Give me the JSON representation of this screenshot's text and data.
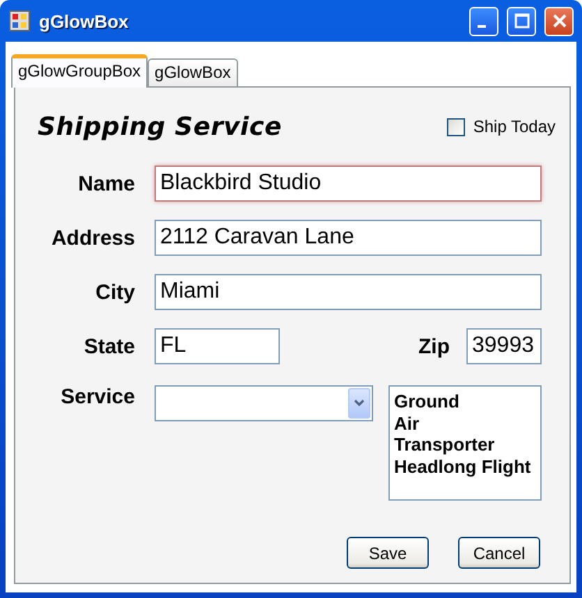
{
  "window": {
    "title": "gGlowBox"
  },
  "tabs": [
    {
      "label": "gGlowGroupBox",
      "selected": true
    },
    {
      "label": "gGlowBox",
      "selected": false
    }
  ],
  "group": {
    "title": "Shipping Service",
    "ship_today": {
      "label": "Ship Today",
      "checked": false
    }
  },
  "fields": [
    {
      "label": "Name",
      "value": "Blackbird Studio",
      "focused": true
    },
    {
      "label": "Address",
      "value": "2112 Caravan Lane",
      "focused": false
    },
    {
      "label": "City",
      "value": "Miami",
      "focused": false
    }
  ],
  "state": {
    "label": "State",
    "value": "FL",
    "focused": false
  },
  "zip": {
    "label": "Zip",
    "value": "39993",
    "focused": false
  },
  "service": {
    "label": "Service"
  },
  "service_list": [
    {
      "label": "Ground",
      "selected": false
    },
    {
      "label": "Air",
      "selected": false
    },
    {
      "label": "Transporter",
      "selected": false
    },
    {
      "label": "Headlong Flight",
      "selected": false
    }
  ],
  "buttons": [
    {
      "label": "Save"
    },
    {
      "label": "Cancel"
    }
  ]
}
